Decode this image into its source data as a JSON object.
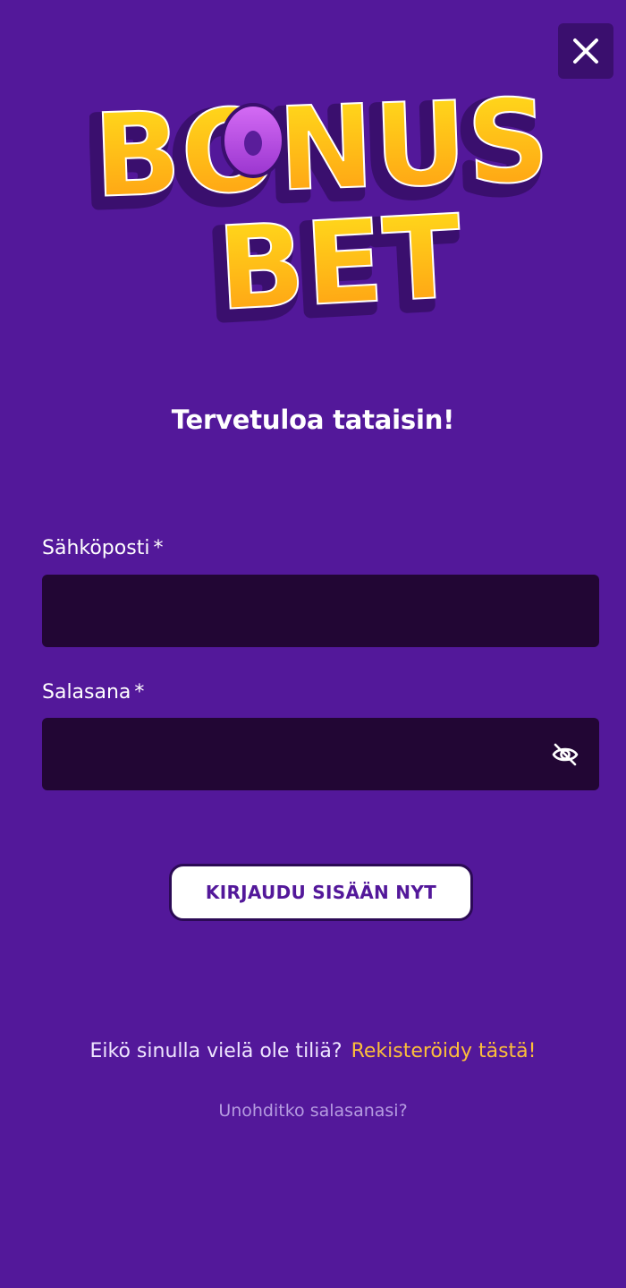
{
  "dialog": {
    "close_icon": "close-icon"
  },
  "logo": {
    "line1": "BONUS",
    "line2": "BET",
    "colors": {
      "letter_fill_top": "#ffe01c",
      "letter_fill_bottom": "#ff9a13",
      "o_ring": "#c351ef",
      "outline": "#3a0f6e"
    }
  },
  "welcome": {
    "title": "Tervetuloa tataisin!"
  },
  "form": {
    "email": {
      "label": "Sähköposti",
      "required_mark": "*",
      "value": "",
      "placeholder": ""
    },
    "password": {
      "label": "Salasana",
      "required_mark": "*",
      "value": "",
      "placeholder": "",
      "toggle_icon": "eye-slash-icon"
    },
    "submit_label": "KIRJAUDU SISÄÄN NYT"
  },
  "footer": {
    "register_prompt": "Eikö sinulla vielä ole tiliä?",
    "register_link": "Rekisteröidy tästä!",
    "forgot_link": "Unohditko salasanasi?"
  },
  "colors": {
    "background": "#53189a",
    "input_background": "#220634",
    "close_button_background": "#3a0f6e",
    "button_background": "#ffffff",
    "button_text": "#53189a",
    "link_accent": "#fdbf3a",
    "muted_link": "#b59be0"
  }
}
